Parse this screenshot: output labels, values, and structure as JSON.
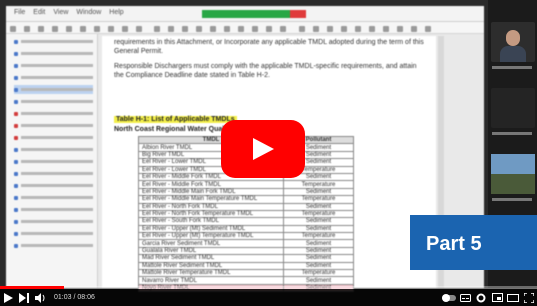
{
  "video": {
    "badge_label": "Part 5",
    "progress_fraction": 0.12,
    "time_display": "01:03 / 08:06"
  },
  "screen": {
    "menu": [
      "File",
      "Edit",
      "View",
      "Window",
      "Help"
    ],
    "doc_paragraph_1": "requirements in this Attachment, or Incorporate any applicable TMDL adopted during the term of this General Permit.",
    "doc_paragraph_2": "Responsible Dischargers must comply with the applicable TMDL-specific requirements, and attain the Compliance Deadline date stated in Table H-2.",
    "table_title": "Table H-1: List of Applicable TMDLs",
    "table_subtitle": "North Coast Regional Water Quality Control Board",
    "table_header": [
      "TMDL",
      "Pollutant"
    ],
    "table_rows": [
      [
        "Albion River TMDL",
        "Sediment"
      ],
      [
        "Big River TMDL",
        "Sediment"
      ],
      [
        "Eel River - Lower TMDL",
        "Sediment"
      ],
      [
        "Eel River - Lower TMDL",
        "Temperature"
      ],
      [
        "Eel River - Middle Fork TMDL",
        "Sediment"
      ],
      [
        "Eel River - Middle Fork TMDL",
        "Temperature"
      ],
      [
        "Eel River - Middle Main Fork TMDL",
        "Sediment"
      ],
      [
        "Eel River - Middle Main Temperature TMDL",
        "Temperature"
      ],
      [
        "Eel River - North Fork TMDL",
        "Sediment"
      ],
      [
        "Eel River - North Fork Temperature TMDL",
        "Temperature"
      ],
      [
        "Eel River - South Fork TMDL",
        "Sediment"
      ],
      [
        "Eel River - Upper (Mt) Sediment TMDL",
        "Sediment"
      ],
      [
        "Eel River - Upper (Mt) Temperature TMDL",
        "Temperature"
      ],
      [
        "Garcia River Sediment TMDL",
        "Sediment"
      ],
      [
        "Gualala River TMDL",
        "Sediment"
      ],
      [
        "Mad River Sediment TMDL",
        "Sediment"
      ],
      [
        "Mattole River Sediment TMDL",
        "Sediment"
      ],
      [
        "Mattole River Temperature TMDL",
        "Temperature"
      ],
      [
        "Navarro River TMDL",
        "Sediment"
      ],
      [
        "Noyo River TMDL",
        "Sediment"
      ]
    ]
  },
  "icons": {
    "play": "play-icon",
    "skip": "next-icon",
    "volume": "volume-icon",
    "settings": "gear-icon",
    "fullscreen": "fullscreen-icon"
  },
  "colors": {
    "play_button": "#ff0000",
    "badge": "#1b64b0",
    "highlight": "#f3ef4a"
  }
}
